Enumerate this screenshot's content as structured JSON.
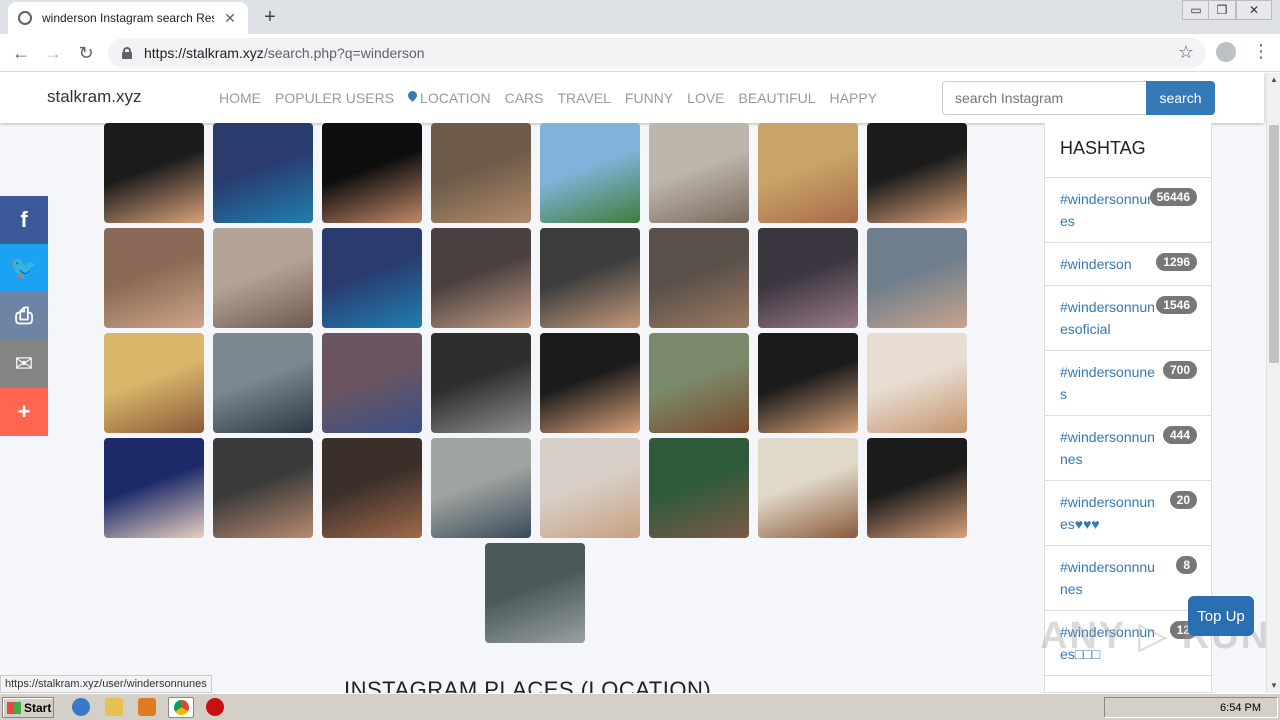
{
  "browser": {
    "tab_title": "winderson Instagram search Result",
    "tab_close": "✕",
    "new_tab": "+",
    "url_host": "https://stalkram.xyz",
    "url_path": "/search.php?q=winderson",
    "window_controls": [
      "▭",
      "❐",
      "✕"
    ],
    "status_url": "https://stalkram.xyz/user/windersonnunes"
  },
  "site": {
    "brand": "stalkram.xyz",
    "nav": [
      "HOME",
      "POPULER USERS",
      "LOCATION",
      "CARS",
      "TRAVEL",
      "FUNNY",
      "LOVE",
      "BEAUTIFUL",
      "HAPPY"
    ],
    "search_placeholder": "search Instagram",
    "search_button": "search"
  },
  "share_buttons": [
    {
      "icon": "facebook-icon",
      "glyph": "f",
      "color": "#3b5998"
    },
    {
      "icon": "twitter-icon",
      "glyph": "🐦",
      "color": "#1da1f2"
    },
    {
      "icon": "print-icon",
      "glyph": "⎙",
      "color": "#6d84a4"
    },
    {
      "icon": "email-icon",
      "glyph": "✉",
      "color": "#848484"
    },
    {
      "icon": "more-icon",
      "glyph": "+",
      "color": "#ff6550"
    }
  ],
  "hashtags": {
    "heading": "HASHTAG",
    "items": [
      {
        "tag": "#windersonnunes",
        "count": "56446"
      },
      {
        "tag": "#winderson",
        "count": "1296"
      },
      {
        "tag": "#windersonnunesoficial",
        "count": "1546"
      },
      {
        "tag": "#windersonunes",
        "count": "700"
      },
      {
        "tag": "#windersonnunnes",
        "count": "444"
      },
      {
        "tag": "#windersonnunes♥♥♥",
        "count": "20"
      },
      {
        "tag": "#windersonnnunes",
        "count": "8"
      },
      {
        "tag": "#windersonnunes□□□",
        "count": "12"
      }
    ]
  },
  "photos": [
    {
      "colors": [
        "#1b1b1b",
        "#d9a27a"
      ]
    },
    {
      "colors": [
        "#2a3b6e",
        "#1f7fb0"
      ]
    },
    {
      "colors": [
        "#0d0d0d",
        "#c28a6a"
      ]
    },
    {
      "colors": [
        "#6d5a48",
        "#b08a6c"
      ]
    },
    {
      "colors": [
        "#7fb3d9",
        "#3f7d3a"
      ]
    },
    {
      "colors": [
        "#bcb6ad",
        "#7b6a5c"
      ]
    },
    {
      "colors": [
        "#c9a468",
        "#a86b4a"
      ]
    },
    {
      "colors": [
        "#1b1b1b",
        "#d9a27a"
      ]
    },
    {
      "colors": [
        "#8a6a56",
        "#d0a58a"
      ]
    },
    {
      "colors": [
        "#b4a496",
        "#6d5a4f"
      ]
    },
    {
      "colors": [
        "#2a3b6e",
        "#1f7fb0"
      ]
    },
    {
      "colors": [
        "#4a4040",
        "#c09a80"
      ]
    },
    {
      "colors": [
        "#3d3d3d",
        "#c49a7a"
      ]
    },
    {
      "colors": [
        "#585049",
        "#9c7a60"
      ]
    },
    {
      "colors": [
        "#3b3640",
        "#9b7c88"
      ]
    },
    {
      "colors": [
        "#6e7e8c",
        "#c7a48e"
      ]
    },
    {
      "colors": [
        "#d8b76a",
        "#8c5a3a"
      ]
    },
    {
      "colors": [
        "#7a8890",
        "#2c3844"
      ]
    },
    {
      "colors": [
        "#6a5560",
        "#3c4f88"
      ]
    },
    {
      "colors": [
        "#2e2e2e",
        "#8f8f8f"
      ]
    },
    {
      "colors": [
        "#1b1b1b",
        "#d9a27a"
      ]
    },
    {
      "colors": [
        "#7b8a6a",
        "#7a4a30"
      ]
    },
    {
      "colors": [
        "#1b1b1b",
        "#d9a27a"
      ]
    },
    {
      "colors": [
        "#e8ddd2",
        "#c5956f"
      ]
    },
    {
      "colors": [
        "#1c2a6a",
        "#e8d0c0"
      ]
    },
    {
      "colors": [
        "#3a3a3a",
        "#b88a70"
      ]
    },
    {
      "colors": [
        "#3b2f2a",
        "#a06a4a"
      ]
    },
    {
      "colors": [
        "#a0a4a0",
        "#3a4a5a"
      ]
    },
    {
      "colors": [
        "#d8d0c8",
        "#c8a080"
      ]
    },
    {
      "colors": [
        "#2f5a3a",
        "#7a5a48"
      ]
    },
    {
      "colors": [
        "#e0d8c8",
        "#8a5a3a"
      ]
    },
    {
      "colors": [
        "#1b1b1b",
        "#d9a27a"
      ]
    },
    {
      "colors": [
        "#4a5a5a",
        "#9aa0a0"
      ]
    }
  ],
  "places_title": "INSTAGRAM PLACES (LOCATION)",
  "top_up": "Top Up",
  "watermark": "ANY ▷ RUN",
  "taskbar": {
    "start": "Start",
    "clock": "6:54 PM"
  }
}
